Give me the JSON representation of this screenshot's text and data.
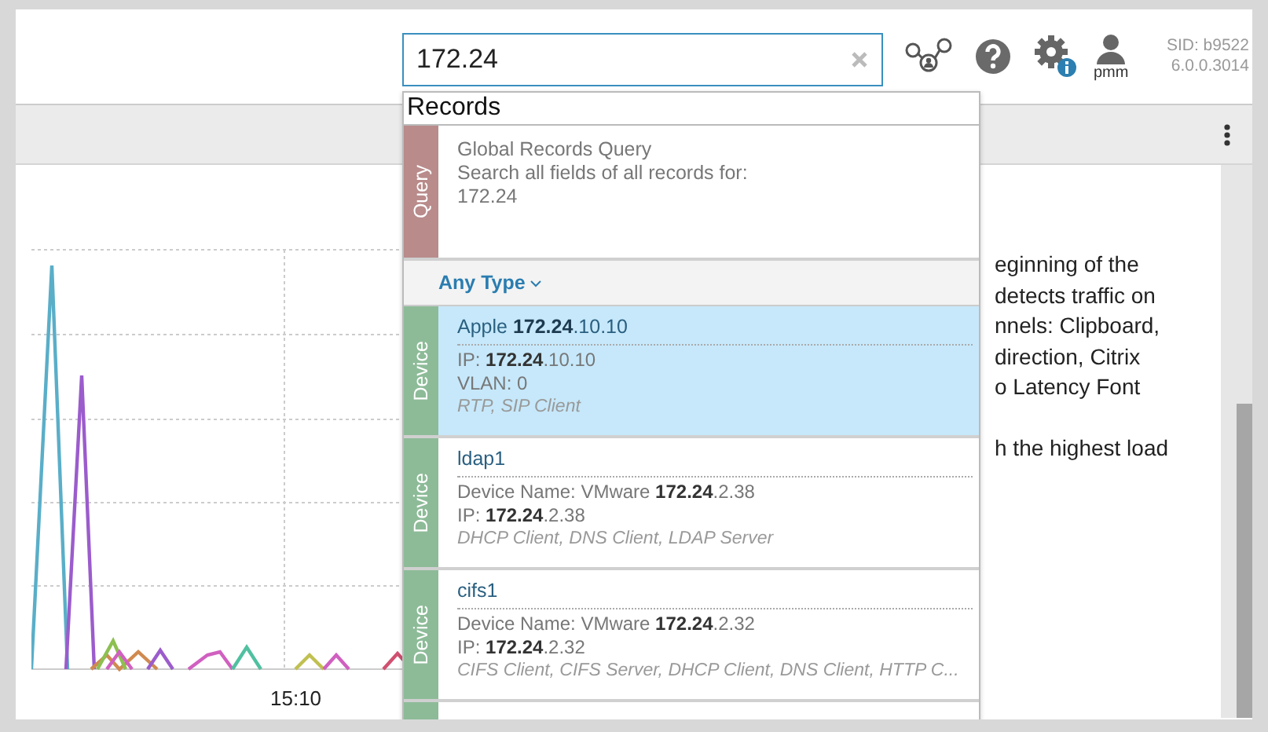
{
  "header": {
    "search": {
      "value": "172.24"
    },
    "user": "pmm",
    "sid": "SID: b9522",
    "version": "6.0.0.3014"
  },
  "chart": {
    "x_label": "15:10"
  },
  "description": {
    "paragraphs": [
      [
        "eginning of the",
        "detects traffic on",
        "nnels: Clipboard,",
        "direction, Citrix",
        "o Latency Font"
      ],
      [
        "h the highest load"
      ]
    ]
  },
  "dropdown": {
    "heading": "Records",
    "query": {
      "tag": "Query",
      "title": "Global Records Query",
      "line": "Search all fields of all records for:",
      "term": "172.24"
    },
    "filter": "Any Type",
    "results": [
      {
        "kind": "device",
        "tag": "Device",
        "name": "Apple **172.24**.10.10",
        "lines": [
          "IP: **172.24**.10.10",
          "VLAN: 0"
        ],
        "services": "RTP, SIP Client",
        "selected": true
      },
      {
        "kind": "device",
        "tag": "Device",
        "name": "ldap1",
        "lines": [
          "Device Name: VMware **172.24**.2.38",
          "IP: **172.24**.2.38"
        ],
        "services": "DHCP Client, DNS Client, LDAP Server",
        "selected": false
      },
      {
        "kind": "device",
        "tag": "Device",
        "name": "cifs1",
        "lines": [
          "Device Name: VMware **172.24**.2.32",
          "IP: **172.24**.2.32"
        ],
        "services": "CIFS Client, CIFS Server, DHCP Client, DNS Client, HTTP C...",
        "selected": false
      }
    ]
  }
}
